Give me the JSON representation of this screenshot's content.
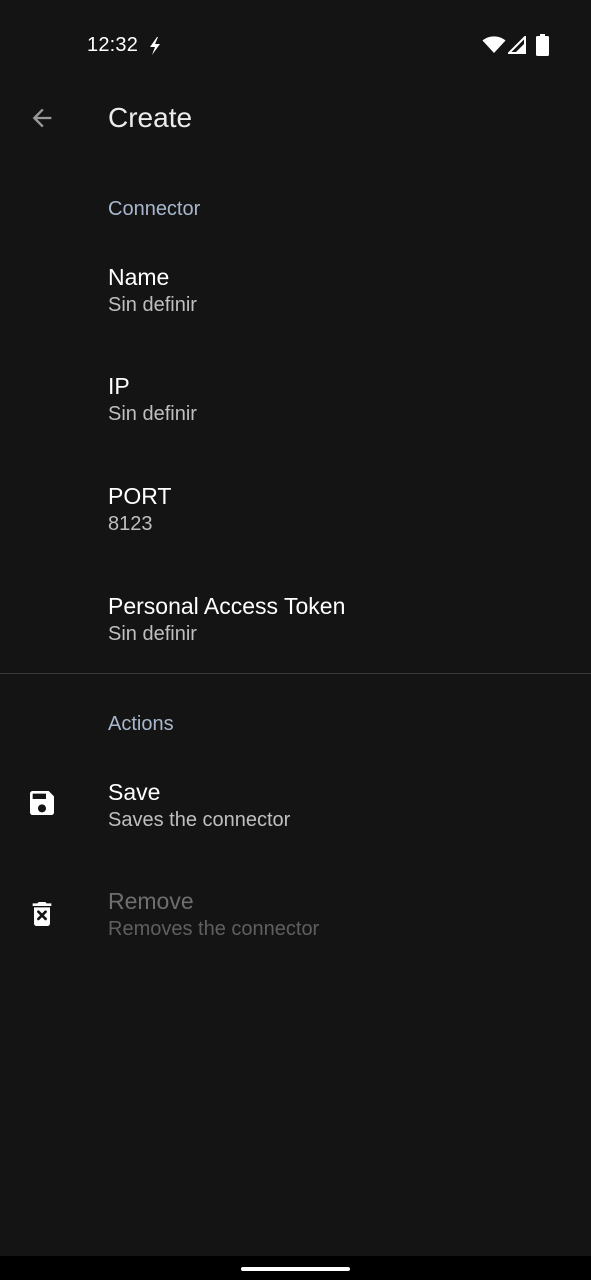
{
  "status_bar": {
    "time": "12:32",
    "icons": [
      "bolt-icon",
      "wifi-icon",
      "cell-signal-icon",
      "battery-icon"
    ]
  },
  "toolbar": {
    "back_icon": "arrow-back-icon",
    "title": "Create"
  },
  "sections": {
    "connector": {
      "header": "Connector",
      "items": [
        {
          "title": "Name",
          "summary": "Sin definir"
        },
        {
          "title": "IP",
          "summary": "Sin definir"
        },
        {
          "title": "PORT",
          "summary": "8123"
        },
        {
          "title": "Personal Access Token",
          "summary": "Sin definir"
        }
      ]
    },
    "actions": {
      "header": "Actions",
      "items": [
        {
          "title": "Save",
          "summary": "Saves the connector",
          "icon": "save-icon",
          "enabled": true
        },
        {
          "title": "Remove",
          "summary": "Removes the connector",
          "icon": "delete-icon",
          "enabled": false
        }
      ]
    }
  },
  "colors": {
    "background": "#141414",
    "section_header": "#a8b7cc",
    "title_text": "#ffffff",
    "summary_text": "#bfbfbf",
    "disabled_text": "#6e6e6e"
  }
}
